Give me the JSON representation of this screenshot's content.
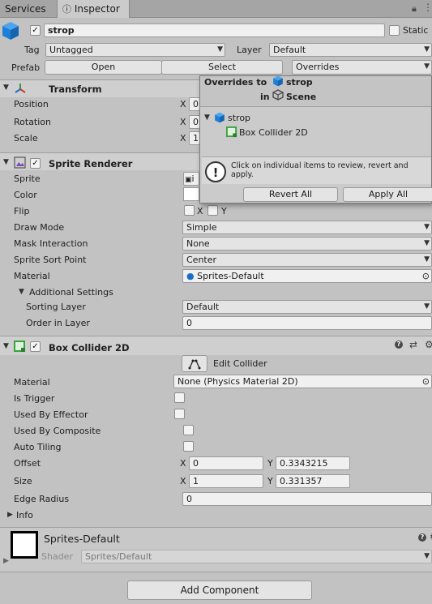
{
  "tabs": {
    "services": "Services",
    "inspector": "Inspector"
  },
  "header": {
    "object_name": "strop",
    "static_label": "Static",
    "tag_label": "Tag",
    "tag_value": "Untagged",
    "layer_label": "Layer",
    "layer_value": "Default",
    "prefab_label": "Prefab",
    "open": "Open",
    "select": "Select",
    "overrides": "Overrides"
  },
  "transform": {
    "title": "Transform",
    "position": "Position",
    "rotation": "Rotation",
    "scale": "Scale",
    "x": "X",
    "pos_x": "0",
    "rot_x": "0",
    "scale_x": "1"
  },
  "sprite_renderer": {
    "title": "Sprite Renderer",
    "sprite": "Sprite",
    "sprite_value": "i",
    "color": "Color",
    "flip": "Flip",
    "flip_x": "X",
    "flip_y": "Y",
    "draw_mode": "Draw Mode",
    "draw_mode_value": "Simple",
    "mask_interaction": "Mask Interaction",
    "mask_interaction_value": "None",
    "sort_point": "Sprite Sort Point",
    "sort_point_value": "Center",
    "material": "Material",
    "material_value": "Sprites-Default",
    "additional": "Additional Settings",
    "sorting_layer": "Sorting Layer",
    "sorting_layer_value": "Default",
    "order": "Order in Layer",
    "order_value": "0"
  },
  "box_collider": {
    "title": "Box Collider 2D",
    "edit_collider": "Edit Collider",
    "material": "Material",
    "material_value": "None (Physics Material 2D)",
    "is_trigger": "Is Trigger",
    "used_by_effector": "Used By Effector",
    "used_by_composite": "Used By Composite",
    "auto_tiling": "Auto Tiling",
    "offset": "Offset",
    "offset_x": "0",
    "offset_y": "0.3343215",
    "size": "Size",
    "size_x": "1",
    "size_y": "0.331357",
    "edge_radius": "Edge Radius",
    "edge_radius_value": "0",
    "info": "Info",
    "x": "X",
    "y": "Y"
  },
  "material_preview": {
    "name": "Sprites-Default",
    "shader_label": "Shader",
    "shader_value": "Sprites/Default"
  },
  "add_component": "Add Component",
  "popup": {
    "line1": "Overrides to",
    "object": "strop",
    "in": "in",
    "scene": "Scene",
    "tree_root": "strop",
    "tree_child": "Box Collider 2D",
    "message": "Click on individual items to review, revert and apply.",
    "revert_all": "Revert All",
    "apply_all": "Apply All"
  },
  "colors": {
    "background": "#c2c2c2",
    "cube_blue": "#1d7fd6",
    "collider_green": "#3aa23a"
  }
}
